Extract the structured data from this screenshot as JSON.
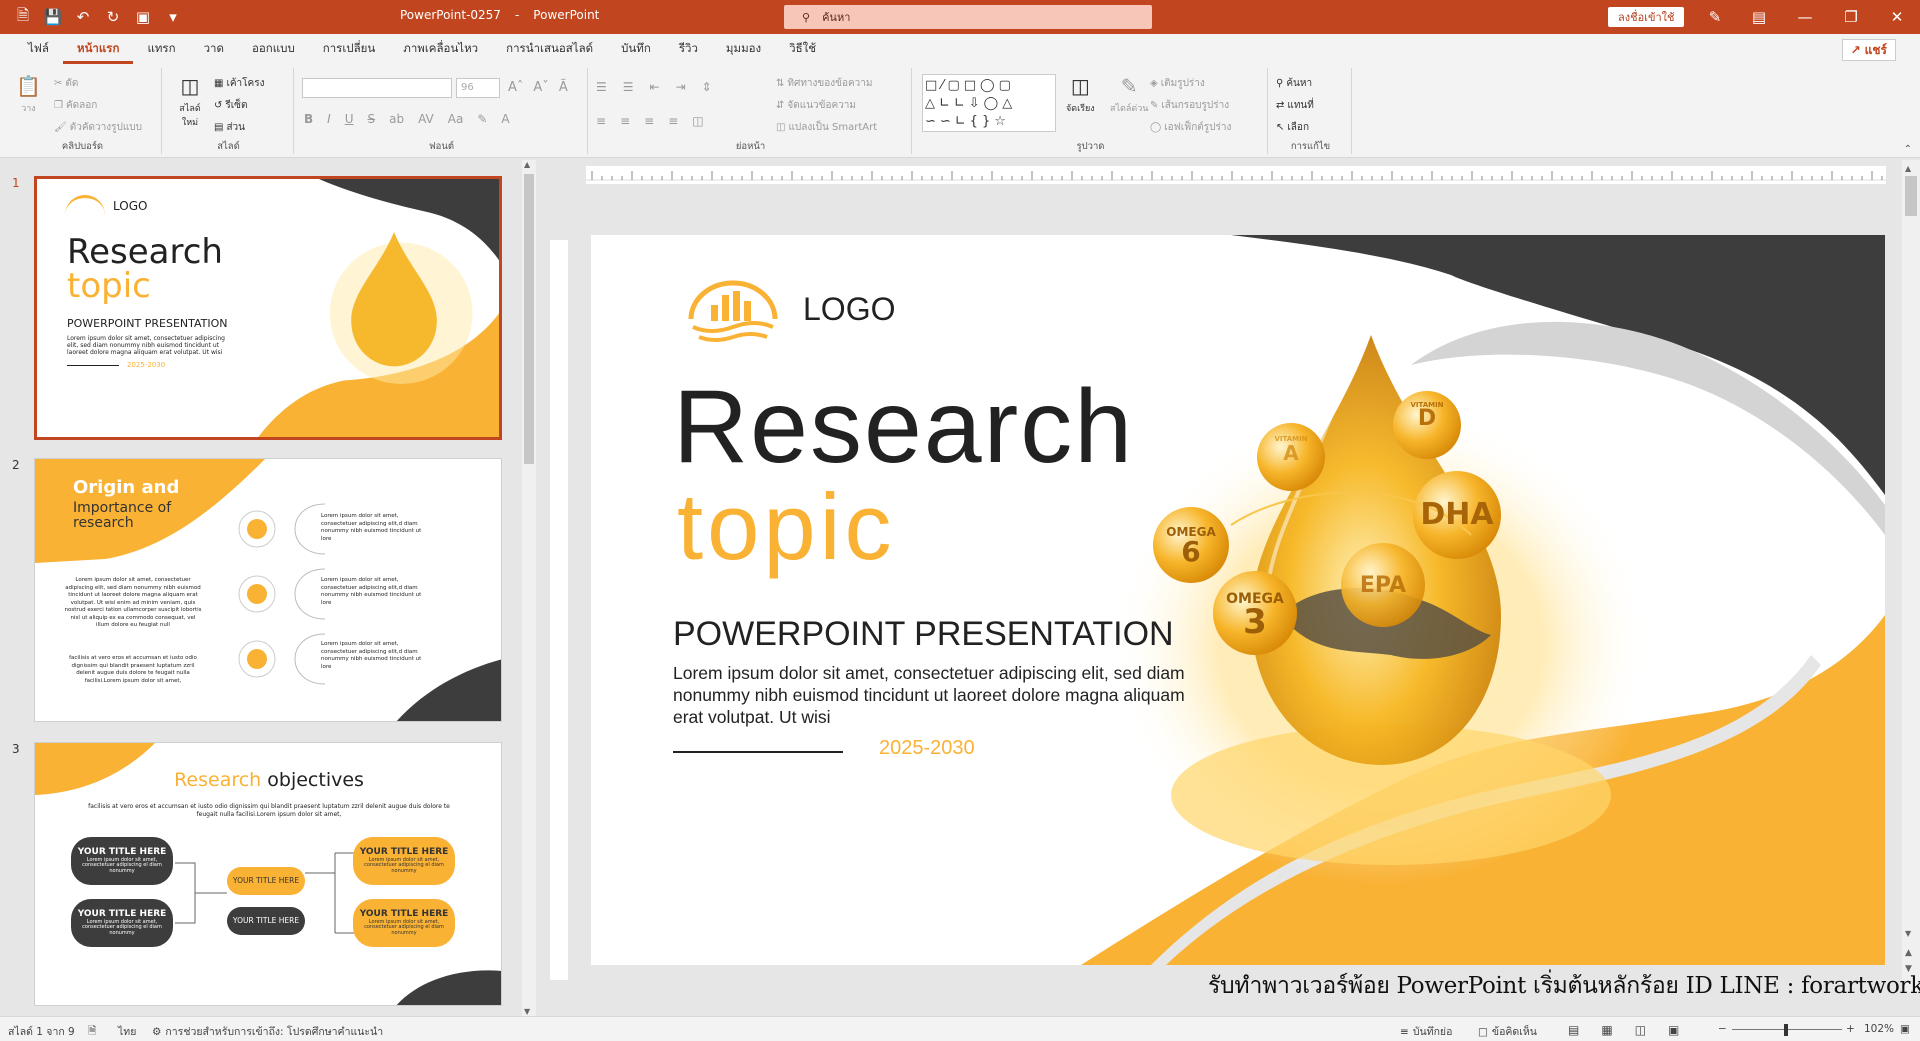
{
  "window": {
    "doc_name": "PowerPoint-0257",
    "app_name": "PowerPoint",
    "search_placeholder": "ค้นหา",
    "signin_label": "ลงชื่อเข้าใช้"
  },
  "tabs": [
    "ไฟล์",
    "หน้าแรก",
    "แทรก",
    "วาด",
    "ออกแบบ",
    "การเปลี่ยน",
    "ภาพเคลื่อนไหว",
    "การนำเสนอสไลด์",
    "บันทึก",
    "รีวิว",
    "มุมมอง",
    "วิธีใช้"
  ],
  "share_label": "แชร์",
  "ribbon": {
    "clipboard": {
      "label": "คลิปบอร์ด",
      "paste": "วาง",
      "cut": "ตัด",
      "copy": "คัดลอก",
      "format_painter": "ตัวคัดวางรูปแบบ"
    },
    "slides": {
      "label": "สไลด์",
      "new_slide": "สไลด์ใหม่",
      "layout": "เค้าโครง",
      "reset": "รีเซ็ต",
      "section": "ส่วน"
    },
    "font": {
      "label": "ฟอนต์",
      "size": "96"
    },
    "paragraph": {
      "label": "ย่อหน้า",
      "text_direction": "ทิศทางของข้อความ",
      "align_text": "จัดแนวข้อความ",
      "smartart": "แปลงเป็น SmartArt"
    },
    "drawing": {
      "label": "รูปวาด",
      "arrange": "จัดเรียง",
      "quick_styles": "สไตล์ด่วน",
      "fill": "เติมรูปร่าง",
      "outline": "เส้นกรอบรูปร่าง",
      "effects": "เอฟเฟ็กต์รูปร่าง"
    },
    "editing": {
      "label": "การแก้ไข",
      "find": "ค้นหา",
      "replace": "แทนที่",
      "select": "เลือก"
    }
  },
  "thumbnails": {
    "numbers": [
      "1",
      "2",
      "3"
    ],
    "s1": {
      "logo": "LOGO",
      "title1": "Research",
      "title2": "topic",
      "subtitle": "POWERPOINT PRESENTATION",
      "body": "Lorem ipsum dolor sit amet, consectetuer adipiscing elit, sed diam nonummy nibh euismod tincidunt ut laoreet dolore magna aliquam erat volutpat. Ut wisi",
      "years": "2025-2030"
    },
    "s2": {
      "title_a": "Origin and",
      "title_b": "Importance of research",
      "body1": "Lorem ipsum dolor sit amet, consectetuer adipiscing elit, sed diam nonummy nibh euismod tincidunt ut laoreet dolore magna aliquam erat volutpat. Ut wisi enim ad minim veniam, quis nostrud exerci tation ullamcorper suscipit lobortis nisl ut aliquip ex ea commodo consequat, vel illum dolore eu feugiat null",
      "body2": "facilisis at vero eros et accumsan et iusto odio dignissim qui blandit praesent luptatum zzril delenit augue duis dolore te feugait nulla facilisi.Lorem ipsum dolor sit amet,",
      "item": "Lorem ipsum dolor sit amet, consectetuer adipiscing elit,d diam nonummy nibh euismod tincidunt ut lore"
    },
    "s3": {
      "title_a": "Research ",
      "title_b": "objectives",
      "intro": "facilisis at vero eros et accumsan et iusto odio dignissim qui blandit praesent luptatum zzril delenit augue duis dolore te feugait nulla facilisi.Lorem ipsum dolor sit amet,",
      "pill_title": "YOUR TITLE HERE",
      "pill_body": "Lorem ipsum dolor sit amet, consectetuer adipiscing el diam nonummy",
      "center_a": "YOUR TITLE HERE",
      "center_b": "YOUR TITLE HERE"
    }
  },
  "main_slide": {
    "logo": "LOGO",
    "title_line1": "Research",
    "title_line2": "topic",
    "subtitle": "POWERPOINT PRESENTATION",
    "body": "Lorem ipsum dolor sit amet, consectetuer adipiscing elit, sed diam nonummy nibh euismod tincidunt ut laoreet dolore magna aliquam erat volutpat. Ut wisi",
    "years": "2025-2030",
    "bubbles": {
      "vitamin_d_label": "VITAMIN",
      "vitamin_d": "D",
      "vitamin_a_label": "VITAMIN",
      "vitamin_a": "A",
      "dha": "DHA",
      "epa": "EPA",
      "omega6_label": "OMEGA",
      "omega6": "6",
      "omega3_label": "OMEGA",
      "omega3": "3"
    }
  },
  "watermark": "รับทำพาวเวอร์พ้อย PowerPoint เริ่มต้นหลักร้อย ID LINE : forartwork",
  "status": {
    "slide_info": "สไลด์ 1 จาก 9",
    "language": "ไทย",
    "accessibility": "การช่วยสำหรับการเข้าถึง: โปรดศึกษาคำแนะนำ",
    "notes": "บันทึกย่อ",
    "comments": "ข้อคิดเห็น",
    "zoom": "102%"
  },
  "colors": {
    "accent": "#c1451f",
    "yellow": "#f9b234",
    "dark": "#3d3d3d"
  }
}
